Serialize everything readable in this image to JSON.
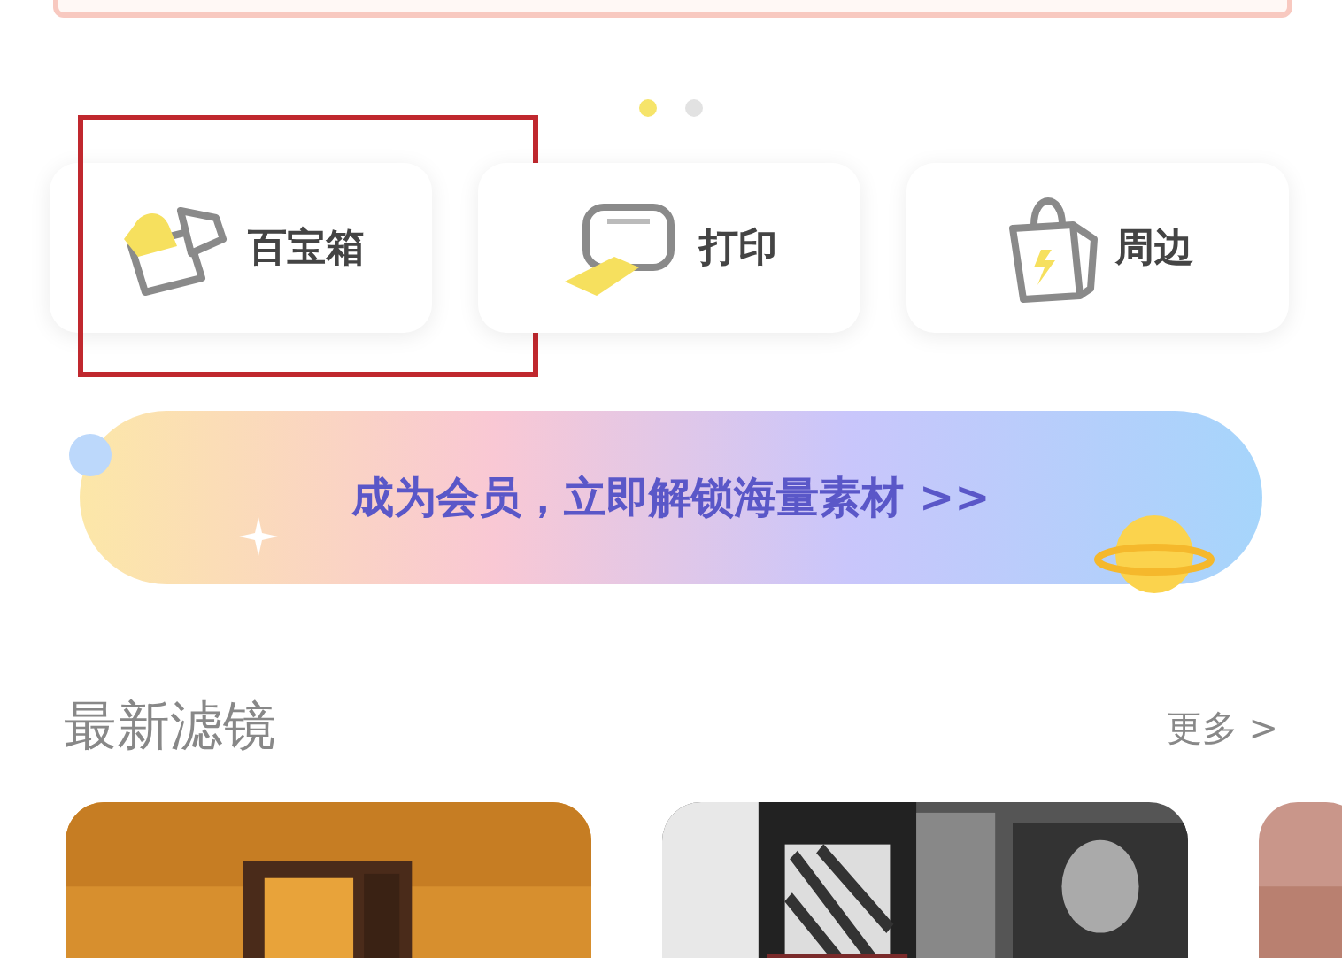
{
  "carousel_dots": [
    {
      "selected": true
    },
    {
      "selected": false
    }
  ],
  "shortcuts": [
    {
      "label": "百宝箱",
      "kind": "toolbox",
      "highlighted": true
    },
    {
      "label": "打印",
      "kind": "printer",
      "highlighted": false
    },
    {
      "label": "周边",
      "kind": "bag",
      "highlighted": false
    }
  ],
  "member_banner": {
    "text": "成为会员，立即解锁海量素材 >>"
  },
  "section": {
    "title": "最新滤镜",
    "more": "更多 >"
  }
}
